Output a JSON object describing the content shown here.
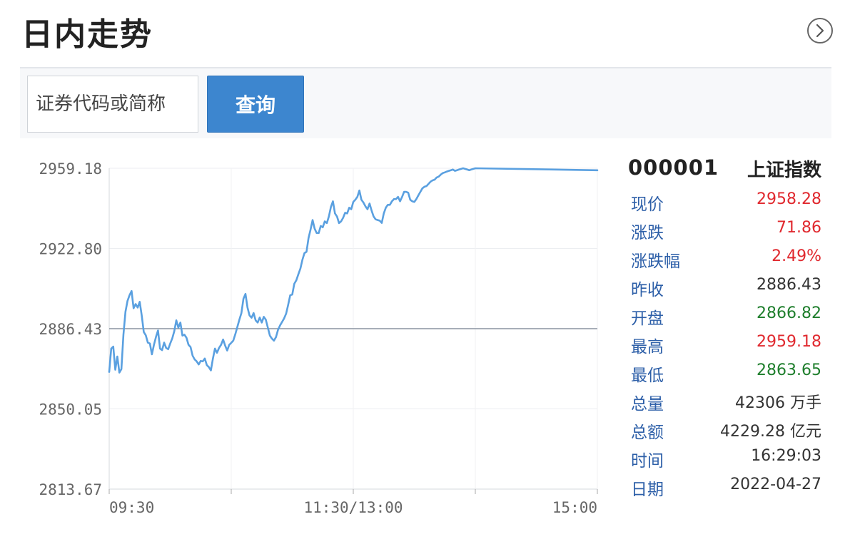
{
  "header": {
    "title": "日内走势"
  },
  "search": {
    "placeholder": "证券代码或简称",
    "button_label": "查询"
  },
  "stock": {
    "code": "000001",
    "name": "上证指数",
    "rows": [
      {
        "label": "现价",
        "value": "2958.28",
        "tone": "up"
      },
      {
        "label": "涨跌",
        "value": "71.86",
        "tone": "up"
      },
      {
        "label": "涨跌幅",
        "value": "2.49%",
        "tone": "up"
      },
      {
        "label": "昨收",
        "value": "2886.43",
        "tone": "neutral"
      },
      {
        "label": "开盘",
        "value": "2866.82",
        "tone": "down"
      },
      {
        "label": "最高",
        "value": "2959.18",
        "tone": "up"
      },
      {
        "label": "最低",
        "value": "2863.65",
        "tone": "down"
      },
      {
        "label": "总量",
        "value": "42306 万手",
        "tone": "neutral"
      },
      {
        "label": "总额",
        "value": "4229.28 亿元",
        "tone": "neutral"
      },
      {
        "label": "时间",
        "value": "16:29:03",
        "tone": "neutral"
      },
      {
        "label": "日期",
        "value": "2022-04-27",
        "tone": "neutral"
      }
    ]
  },
  "colors": {
    "accent": "#3d86cf",
    "line": "#5aa0e0",
    "up": "#e0282e",
    "down": "#1e7e2c",
    "label": "#2d5fa8"
  },
  "chart_data": {
    "type": "line",
    "ylim": [
      2813.67,
      2959.18
    ],
    "xlim": [
      0,
      240
    ],
    "y_ticks": [
      "2959.18",
      "2922.80",
      "2886.43",
      "2850.05",
      "2813.67"
    ],
    "y_tick_values": [
      2959.18,
      2922.8,
      2886.43,
      2850.05,
      2813.67
    ],
    "x_ticks": [
      {
        "label": "09:30",
        "minute": 0
      },
      {
        "label": "11:30/13:00",
        "minute": 120
      },
      {
        "label": "15:00",
        "minute": 240
      }
    ],
    "x_minor_tick_minutes": [
      60,
      180
    ],
    "reference_value": 2886.43,
    "grid": true,
    "series": [
      {
        "points": [
          [
            0,
            2866.8
          ],
          [
            1,
            2877.4
          ],
          [
            2,
            2878.3
          ],
          [
            3,
            2867.8
          ],
          [
            4,
            2873.8
          ],
          [
            5,
            2866.5
          ],
          [
            6,
            2868.1
          ],
          [
            7,
            2883.7
          ],
          [
            8,
            2894.1
          ],
          [
            9,
            2899.0
          ],
          [
            10,
            2901.6
          ],
          [
            11,
            2903.5
          ],
          [
            12,
            2895.7
          ],
          [
            13,
            2897.6
          ],
          [
            14,
            2896.0
          ],
          [
            15,
            2898.6
          ],
          [
            16,
            2892.4
          ],
          [
            17,
            2884.9
          ],
          [
            18,
            2883.4
          ],
          [
            19,
            2880.1
          ],
          [
            20,
            2879.7
          ],
          [
            21,
            2874.8
          ],
          [
            22,
            2879.1
          ],
          [
            23,
            2882.7
          ],
          [
            24,
            2885.6
          ],
          [
            25,
            2877.4
          ],
          [
            26,
            2876.7
          ],
          [
            27,
            2880.1
          ],
          [
            28,
            2877.7
          ],
          [
            29,
            2877.1
          ],
          [
            30,
            2879.7
          ],
          [
            31,
            2882.0
          ],
          [
            32,
            2885.3
          ],
          [
            33,
            2890.2
          ],
          [
            34,
            2886.9
          ],
          [
            35,
            2889.2
          ],
          [
            36,
            2883.3
          ],
          [
            37,
            2883.7
          ],
          [
            38,
            2882.3
          ],
          [
            39,
            2879.1
          ],
          [
            40,
            2878.1
          ],
          [
            41,
            2874.2
          ],
          [
            42,
            2872.5
          ],
          [
            43,
            2871.6
          ],
          [
            44,
            2870.2
          ],
          [
            45,
            2871.8
          ],
          [
            46,
            2871.6
          ],
          [
            47,
            2872.9
          ],
          [
            48,
            2869.9
          ],
          [
            49,
            2869.0
          ],
          [
            50,
            2867.5
          ],
          [
            51,
            2872.9
          ],
          [
            52,
            2877.4
          ],
          [
            53,
            2875.5
          ],
          [
            54,
            2877.7
          ],
          [
            55,
            2879.1
          ],
          [
            56,
            2881.5
          ],
          [
            57,
            2878.8
          ],
          [
            58,
            2876.5
          ],
          [
            59,
            2879.1
          ],
          [
            60,
            2880.0
          ],
          [
            61,
            2881.0
          ],
          [
            62,
            2883.9
          ],
          [
            63,
            2887.2
          ],
          [
            64,
            2890.5
          ],
          [
            65,
            2893.5
          ],
          [
            66,
            2900.0
          ],
          [
            67,
            2902.2
          ],
          [
            68,
            2896.0
          ],
          [
            69,
            2892.4
          ],
          [
            70,
            2891.4
          ],
          [
            71,
            2893.5
          ],
          [
            72,
            2890.2
          ],
          [
            73,
            2889.2
          ],
          [
            74,
            2891.5
          ],
          [
            75,
            2889.2
          ],
          [
            76,
            2891.8
          ],
          [
            77,
            2890.5
          ],
          [
            78,
            2886.9
          ],
          [
            79,
            2883.3
          ],
          [
            80,
            2881.9
          ],
          [
            81,
            2881.0
          ],
          [
            82,
            2882.6
          ],
          [
            83,
            2885.9
          ],
          [
            84,
            2887.9
          ],
          [
            85,
            2889.5
          ],
          [
            86,
            2891.1
          ],
          [
            87,
            2893.3
          ],
          [
            88,
            2897.3
          ],
          [
            89,
            2901.6
          ],
          [
            90,
            2901.9
          ],
          [
            91,
            2906.8
          ],
          [
            92,
            2908.4
          ],
          [
            93,
            2911.1
          ],
          [
            94,
            2913.7
          ],
          [
            95,
            2917.7
          ],
          [
            96,
            2920.7
          ],
          [
            97,
            2921.3
          ],
          [
            98,
            2927.5
          ],
          [
            99,
            2931.4
          ],
          [
            100,
            2935.7
          ],
          [
            101,
            2931.8
          ],
          [
            102,
            2929.8
          ],
          [
            103,
            2929.8
          ],
          [
            104,
            2933.0
          ],
          [
            105,
            2932.4
          ],
          [
            106,
            2935.1
          ],
          [
            107,
            2934.3
          ],
          [
            108,
            2937.3
          ],
          [
            109,
            2941.6
          ],
          [
            110,
            2944.2
          ],
          [
            111,
            2938.7
          ],
          [
            112,
            2937.3
          ],
          [
            113,
            2934.3
          ],
          [
            114,
            2935.1
          ],
          [
            115,
            2936.7
          ],
          [
            116,
            2939.0
          ],
          [
            117,
            2938.7
          ],
          [
            118,
            2941.3
          ],
          [
            119,
            2940.6
          ],
          [
            120,
            2943.9
          ],
          [
            121,
            2944.9
          ],
          [
            122,
            2946.2
          ],
          [
            123,
            2949.1
          ],
          [
            124,
            2944.9
          ],
          [
            125,
            2943.6
          ],
          [
            126,
            2941.9
          ],
          [
            127,
            2940.6
          ],
          [
            128,
            2943.2
          ],
          [
            129,
            2940.0
          ],
          [
            130,
            2937.3
          ],
          [
            131,
            2936.0
          ],
          [
            132,
            2935.7
          ],
          [
            133,
            2935.4
          ],
          [
            134,
            2934.4
          ],
          [
            135,
            2938.7
          ],
          [
            136,
            2941.3
          ],
          [
            137,
            2942.6
          ],
          [
            138,
            2942.6
          ],
          [
            139,
            2944.2
          ],
          [
            140,
            2945.2
          ],
          [
            141,
            2945.2
          ],
          [
            142,
            2946.2
          ],
          [
            143,
            2944.2
          ],
          [
            144,
            2946.2
          ],
          [
            145,
            2948.5
          ],
          [
            146,
            2948.5
          ],
          [
            147,
            2948.1
          ],
          [
            148,
            2944.9
          ],
          [
            149,
            2944.2
          ],
          [
            150,
            2943.9
          ],
          [
            151,
            2945.2
          ],
          [
            152,
            2946.9
          ],
          [
            153,
            2948.5
          ],
          [
            154,
            2950.1
          ],
          [
            155,
            2950.8
          ],
          [
            156,
            2951.1
          ],
          [
            157,
            2952.1
          ],
          [
            158,
            2953.1
          ],
          [
            159,
            2953.7
          ],
          [
            160,
            2954.0
          ],
          [
            161,
            2955.0
          ],
          [
            162,
            2955.4
          ],
          [
            163,
            2956.3
          ],
          [
            164,
            2957.0
          ],
          [
            165,
            2957.3
          ],
          [
            166,
            2957.7
          ],
          [
            167,
            2958.0
          ],
          [
            168,
            2958.3
          ],
          [
            169,
            2958.6
          ],
          [
            170,
            2958.0
          ],
          [
            171,
            2958.3
          ],
          [
            172,
            2958.6
          ],
          [
            173,
            2958.9
          ],
          [
            174,
            2959.18
          ],
          [
            175,
            2958.9
          ],
          [
            176,
            2958.6
          ],
          [
            177,
            2958.3
          ],
          [
            178,
            2958.6
          ],
          [
            179,
            2958.9
          ],
          [
            180,
            2959.18
          ],
          [
            240,
            2958.28
          ]
        ]
      }
    ]
  }
}
